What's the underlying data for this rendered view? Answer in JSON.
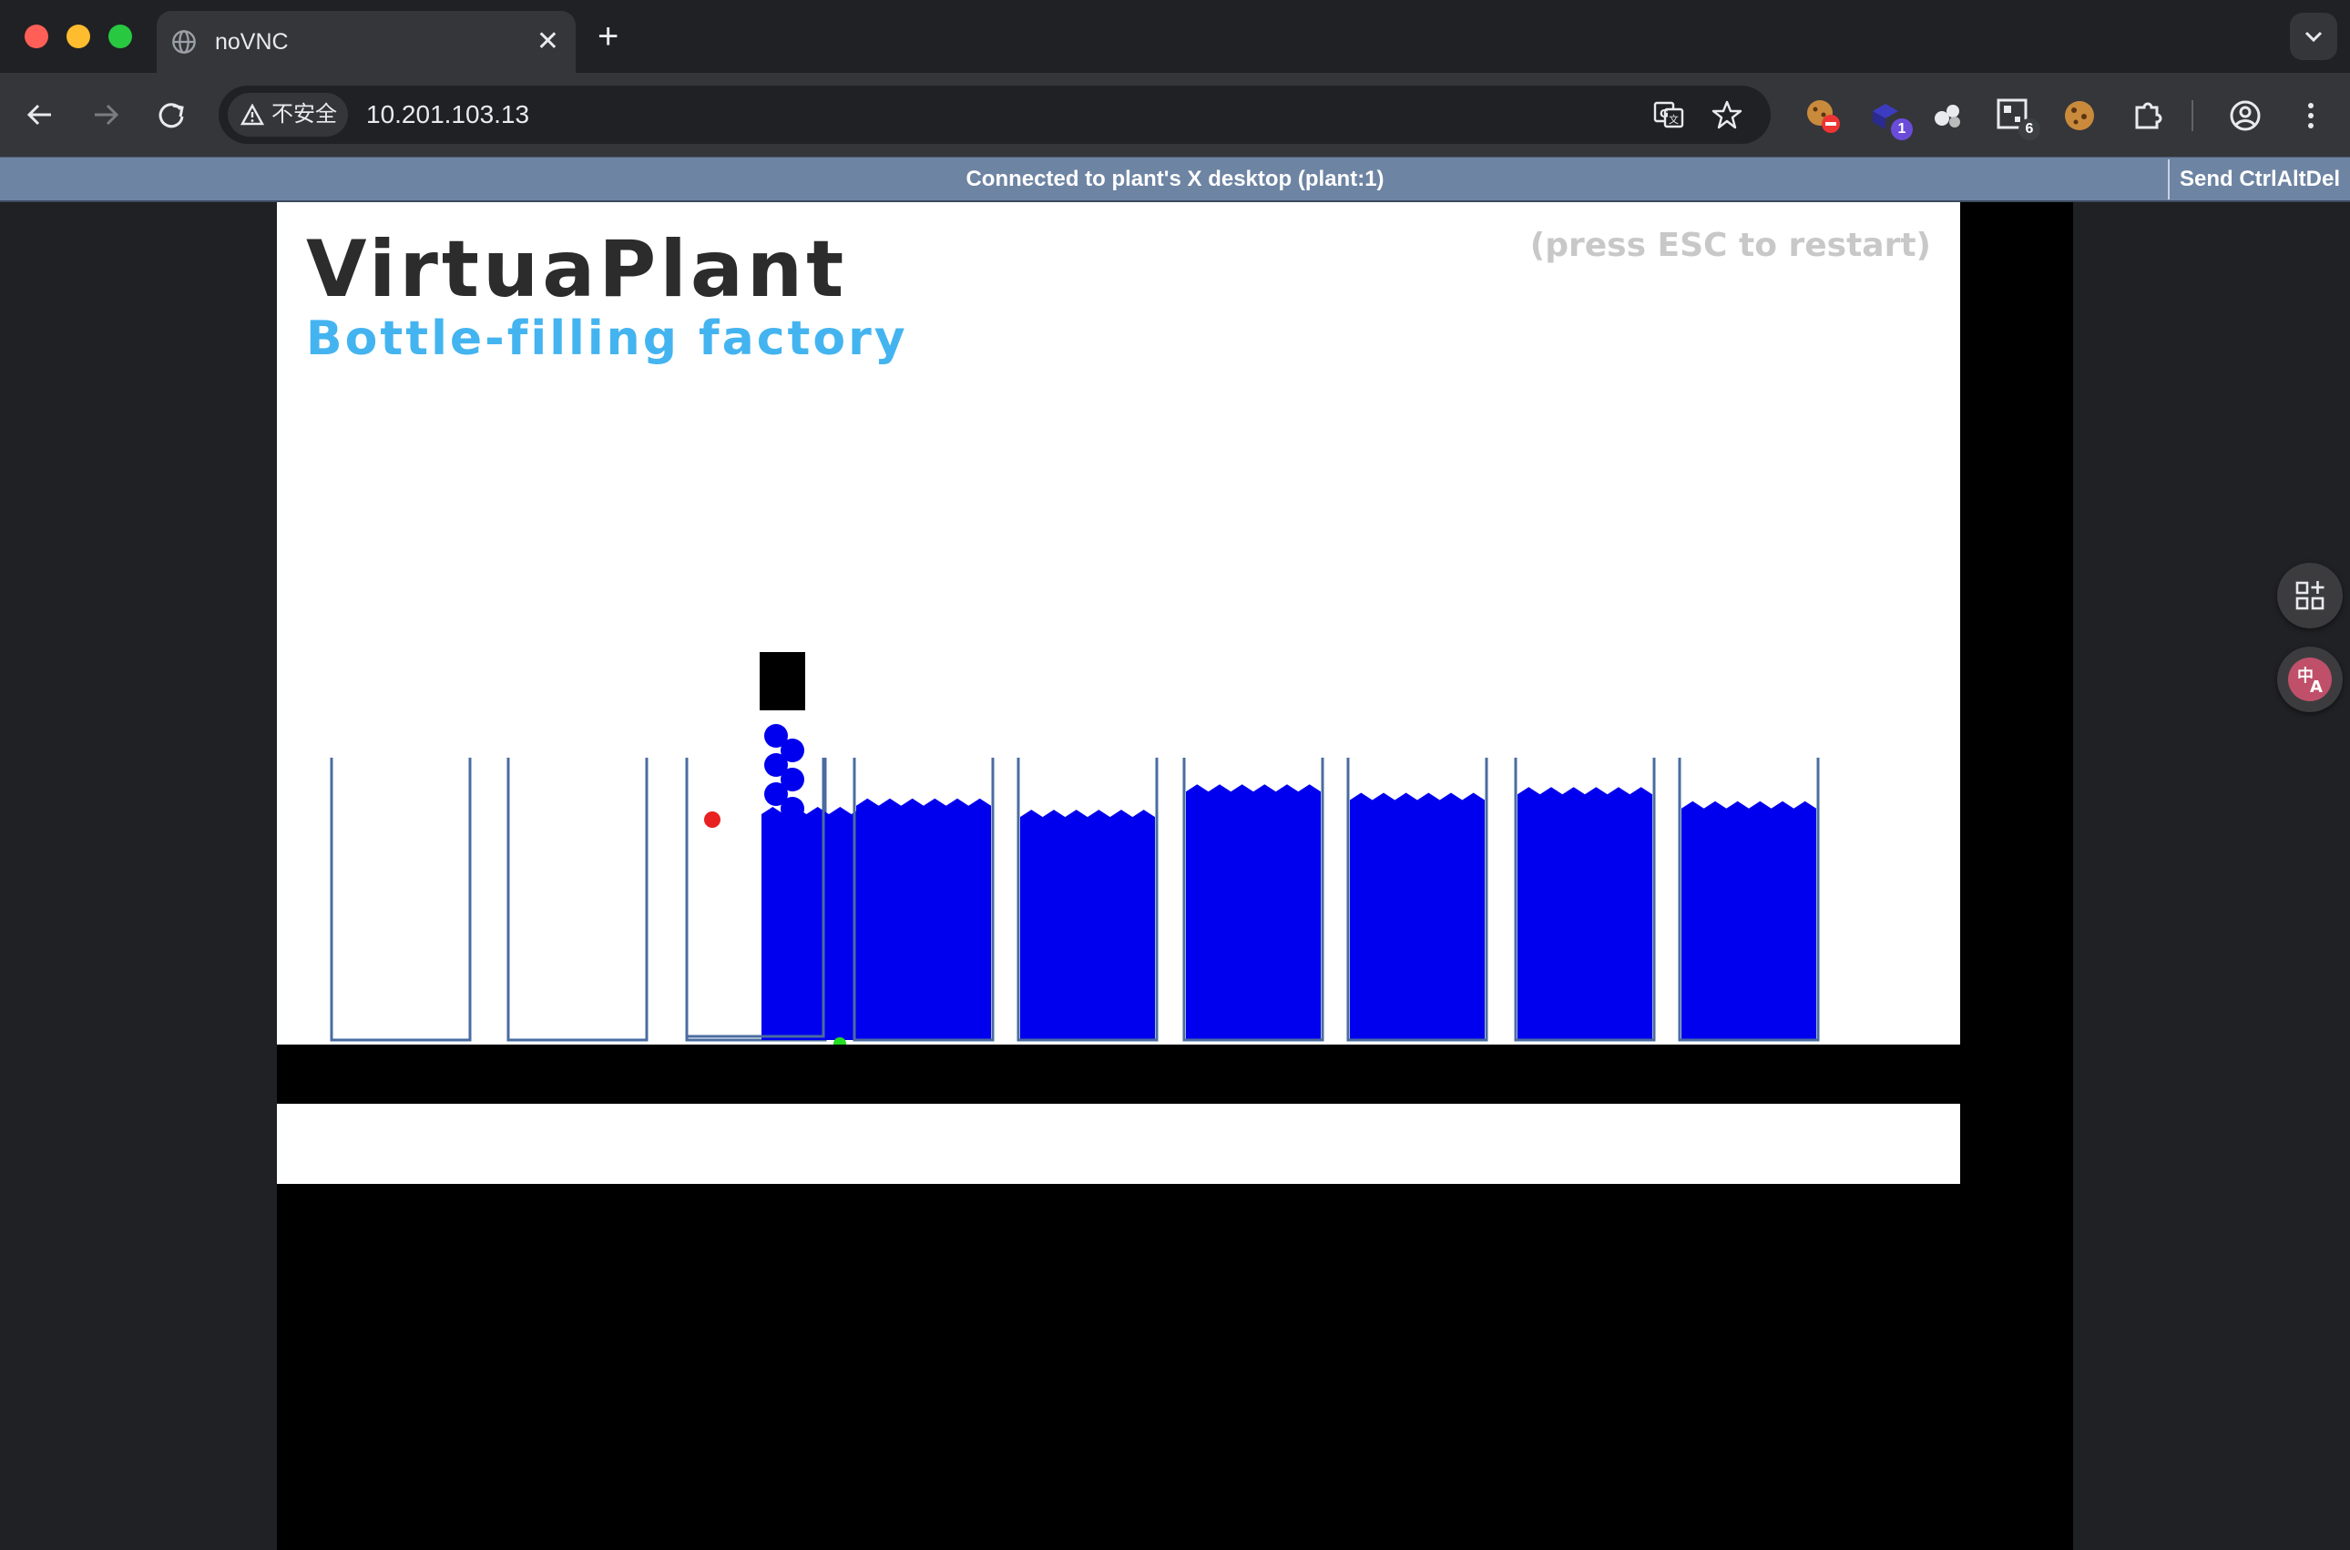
{
  "browser": {
    "tab_title": "noVNC",
    "tab_close": "✕",
    "new_tab": "+",
    "security_label": "不安全",
    "url": "10.201.103.13",
    "extensions": [
      {
        "name": "cookie-blocker-extension",
        "badge": ""
      },
      {
        "name": "puzzle-extension-1",
        "badge": "1"
      },
      {
        "name": "bubbles-extension",
        "badge": ""
      },
      {
        "name": "qr-extension",
        "badge": "6"
      },
      {
        "name": "cookie-extension",
        "badge": ""
      }
    ]
  },
  "vnc": {
    "status": "Connected to plant's X desktop (plant:1)",
    "ctrl_alt_del": "Send CtrlAltDel"
  },
  "plant": {
    "title": "VirtuaPlant",
    "subtitle": "Bottle-filling factory",
    "hint": "(press ESC to restart)",
    "bottles": [
      {
        "fill": 0
      },
      {
        "fill": 0
      },
      {
        "fill": 0
      },
      {
        "fill": 0.8
      },
      {
        "fill": 0.83
      },
      {
        "fill": 0.79
      },
      {
        "fill": 0.88
      },
      {
        "fill": 0.85
      },
      {
        "fill": 0.87
      },
      {
        "fill": 0.82
      }
    ],
    "colors": {
      "liquid": "#0000ee",
      "bottle_outline": "#4a6ca0",
      "sensor_red": "#e82020",
      "sensor_green": "#22dd22",
      "nozzle": "#000000"
    }
  }
}
